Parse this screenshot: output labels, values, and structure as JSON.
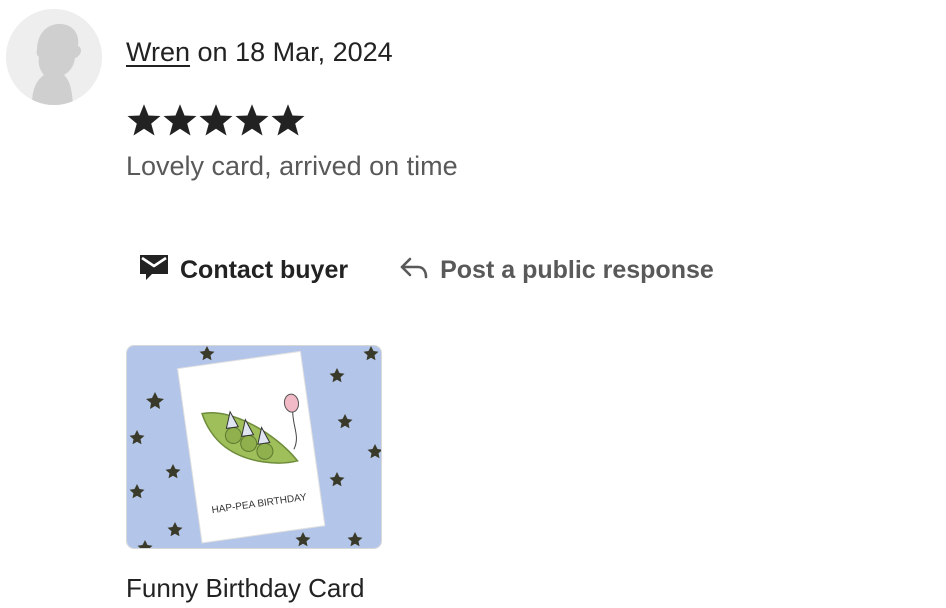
{
  "review": {
    "reviewer_name": "Wren",
    "date_prefix": " on ",
    "date": "18 Mar, 2024",
    "rating": 5,
    "rating_max": 5,
    "text": "Lovely card, arrived on time"
  },
  "actions": {
    "contact_label": "Contact buyer",
    "reply_label": "Post a public response"
  },
  "product": {
    "title": "Funny Birthday Card",
    "card_text": "HAP-PEA BIRTHDAY"
  },
  "icons": {
    "avatar": "person-silhouette-icon",
    "star": "star-icon",
    "contact": "envelope-icon",
    "reply": "reply-arrow-icon"
  },
  "colors": {
    "text_primary": "#222222",
    "text_secondary": "#595959",
    "star": "#222222",
    "card_background": "#b3c5e8",
    "pea_pod": "#9fbf5a"
  }
}
